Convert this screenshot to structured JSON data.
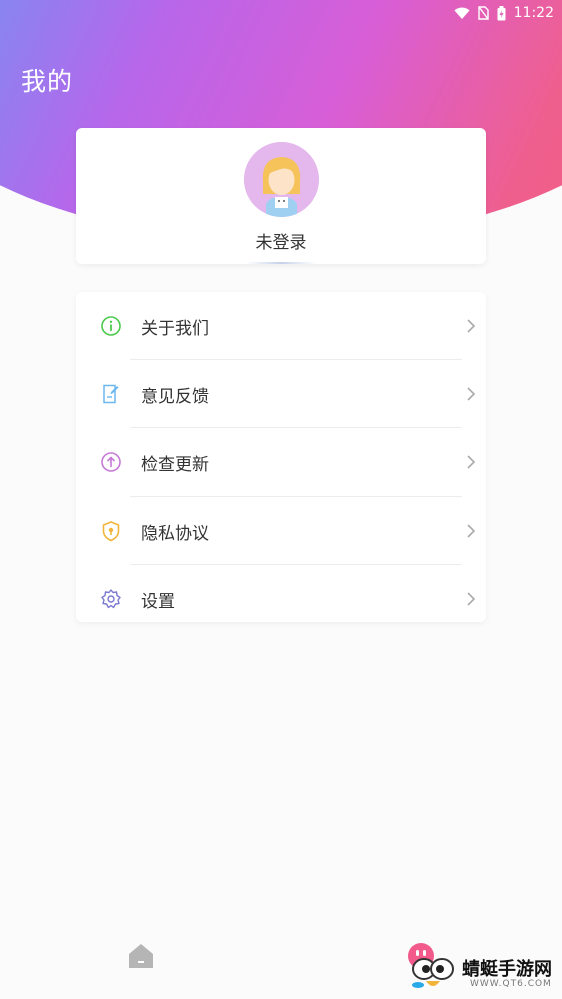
{
  "status_bar": {
    "time": "11:22",
    "icons": [
      "wifi-icon",
      "no-sim-icon",
      "battery-charging-icon"
    ]
  },
  "header": {
    "title": "我的"
  },
  "profile": {
    "login_status": "未登录",
    "avatar_icon": "girl-avatar-icon"
  },
  "menu": {
    "items": [
      {
        "label": "关于我们",
        "icon": "info-icon",
        "color": "#4cc94c"
      },
      {
        "label": "意见反馈",
        "icon": "feedback-edit-icon",
        "color": "#6bb8f0"
      },
      {
        "label": "检查更新",
        "icon": "upload-arrow-icon",
        "color": "#c77ad6"
      },
      {
        "label": "隐私协议",
        "icon": "shield-icon",
        "color": "#f2b43a"
      },
      {
        "label": "设置",
        "icon": "gear-icon",
        "color": "#7a78d0"
      }
    ]
  },
  "bottom_nav": {
    "items": [
      "home-icon",
      "mine-icon"
    ]
  },
  "watermark": {
    "text": "蜻蜓手游网",
    "sub": "WWW.QT6.COM"
  },
  "colors": {
    "gradient_start": "#2fb0f5",
    "gradient_mid": "#b866ea",
    "gradient_end": "#f45a78"
  }
}
